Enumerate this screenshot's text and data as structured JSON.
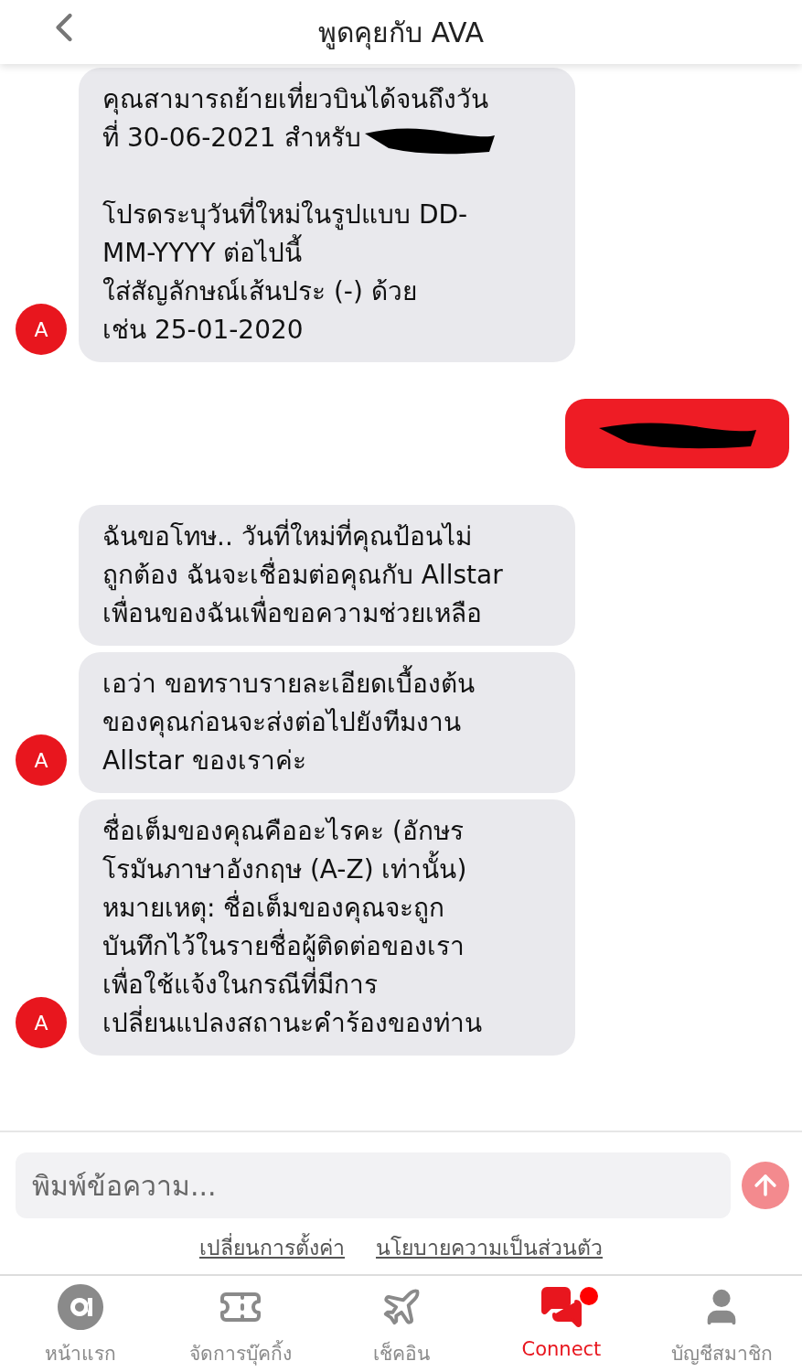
{
  "header": {
    "title": "พูดคุยกับ AVA"
  },
  "messages": [
    {
      "kind": "bot",
      "avatar": "A",
      "text": "คุณสามารถย้ายเที่ยวบินได้จนถึงวัน\nที่ 30-06-2021 สำหรับ",
      "redacted": true,
      "text_after": "\n\nโปรดระบุวันที่ใหม่ในรูปแบบ DD-\nMM-YYYY ต่อไปนี้\nใส่สัญลักษณ์เส้นประ (-) ด้วย\nเช่น 25-01-2020"
    },
    {
      "kind": "user",
      "redacted": true
    },
    {
      "kind": "bot",
      "text": "ฉันขอโทษ.. วันที่ใหม่ที่คุณป้อนไม่\nถูกต้อง ฉันจะเชื่อมต่อคุณกับ Allstar\nเพื่อนของฉันเพื่อขอความช่วยเหลือ"
    },
    {
      "kind": "bot",
      "avatar": "A",
      "text": "เอว่า ขอทราบรายละเอียดเบื้องต้น\nของคุณก่อนจะส่งต่อไปยังทีมงาน\nAllstar ของเราค่ะ"
    },
    {
      "kind": "bot",
      "avatar": "A",
      "text": "ชื่อเต็มของคุณคืออะไรคะ  (อักษร\nโรมันภาษาอังกฤษ (A-Z) เท่านั้น)\nหมายเหตุ: ชื่อเต็มของคุณจะถูก\nบันทึกไว้ในรายชื่อผู้ติดต่อของเรา\nเพื่อใช้แจ้งในกรณีที่มีการ\nเปลี่ยนแปลงสถานะคำร้องของท่าน"
    }
  ],
  "composer": {
    "placeholder": "พิมพ์ข้อความ..."
  },
  "links": [
    "เปลี่ยนการตั้งค่า",
    "นโยบายความเป็นส่วนตัว"
  ],
  "tabs": [
    {
      "kind": "home",
      "label": "หน้าแรก",
      "selected": false,
      "badge": false
    },
    {
      "kind": "booking",
      "label": "จัดการบุ๊คกิ้ง",
      "selected": false,
      "badge": false
    },
    {
      "kind": "checkin",
      "label": "เช็คอิน",
      "selected": false,
      "badge": false
    },
    {
      "kind": "connect",
      "label": "Connect",
      "selected": true,
      "badge": true
    },
    {
      "kind": "account",
      "label": "บัญชีสมาชิก",
      "selected": false,
      "badge": false
    }
  ]
}
